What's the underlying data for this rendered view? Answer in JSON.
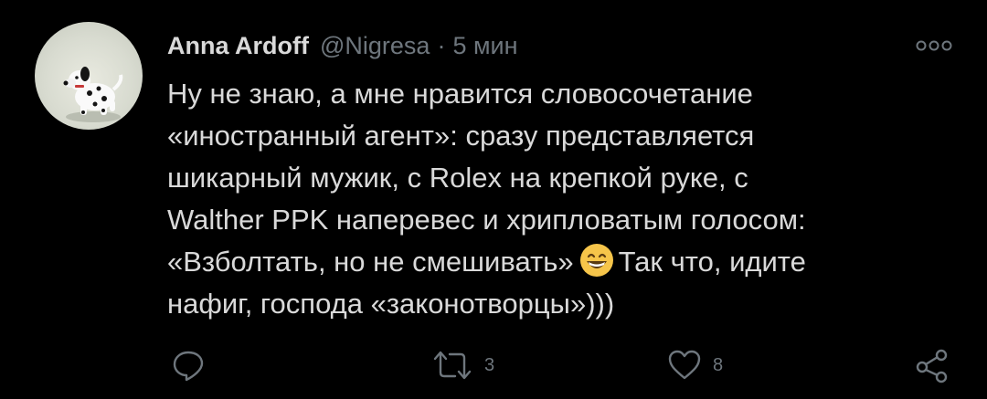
{
  "tweet": {
    "author_name": "Anna Ardoff",
    "handle": "@Nigresa",
    "separator": "·",
    "time": "5 мин",
    "body_lines": [
      "Ну не знаю, а мне нравится словосочетание",
      "«иностранный агент»: сразу представляется",
      "шикарный мужик, с Rolex на крепкой руке, с",
      "Walther PPK наперевес и хрипловатым голосом:",
      "«Взболтать, но не смешивать»",
      "Так что, идите",
      "нафиг, господа «законотворцы»)))"
    ],
    "emoji": "grinning-face-emoji",
    "actions": {
      "reply_icon": "reply-icon",
      "retweet_icon": "retweet-icon",
      "retweet_count": "3",
      "like_icon": "heart-icon",
      "like_count": "8",
      "share_icon": "share-icon"
    },
    "colors": {
      "background": "#000000",
      "text": "#d9d9d9",
      "muted": "#6e767d",
      "emoji": "#f6c54a"
    }
  }
}
